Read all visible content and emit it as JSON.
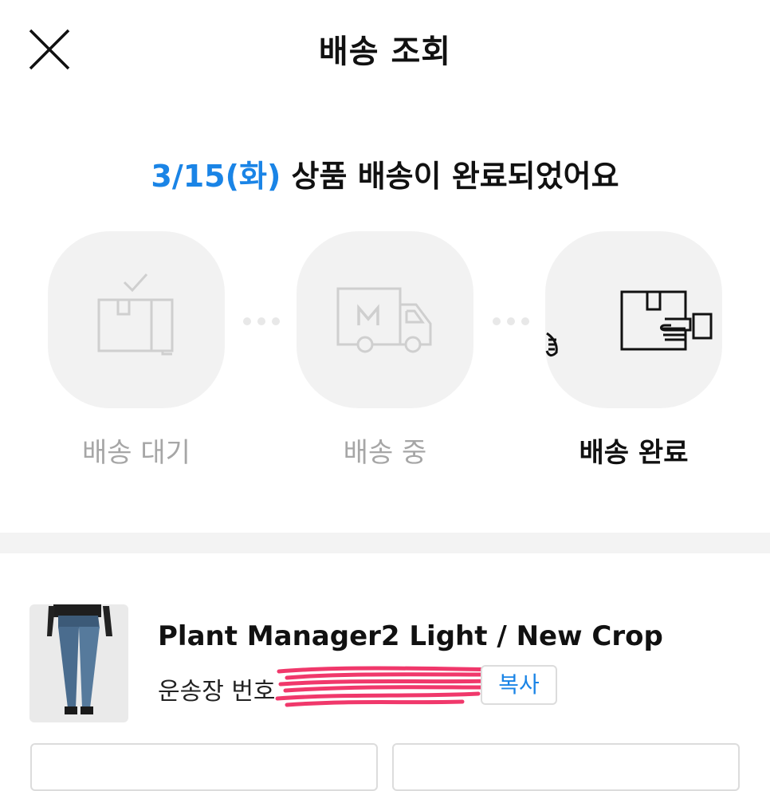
{
  "header": {
    "title": "배송 조회"
  },
  "status": {
    "date": "3/15(화)",
    "message": " 상품 배송이 완료되었어요"
  },
  "steps": [
    {
      "label": "배송 대기",
      "icon": "box-check-icon",
      "state": "done"
    },
    {
      "label": "배송 중",
      "icon": "delivery-truck-icon",
      "state": "done"
    },
    {
      "label": "배송 완료",
      "icon": "box-handover-icon",
      "state": "current"
    }
  ],
  "product": {
    "name": "Plant Manager2 Light / New Crop",
    "tracking_label": "운송장 번호",
    "copy_label": "복사"
  },
  "colors": {
    "accent": "#1a84e6",
    "inactive": "#a6a6a6",
    "redaction": "#f0386b"
  }
}
